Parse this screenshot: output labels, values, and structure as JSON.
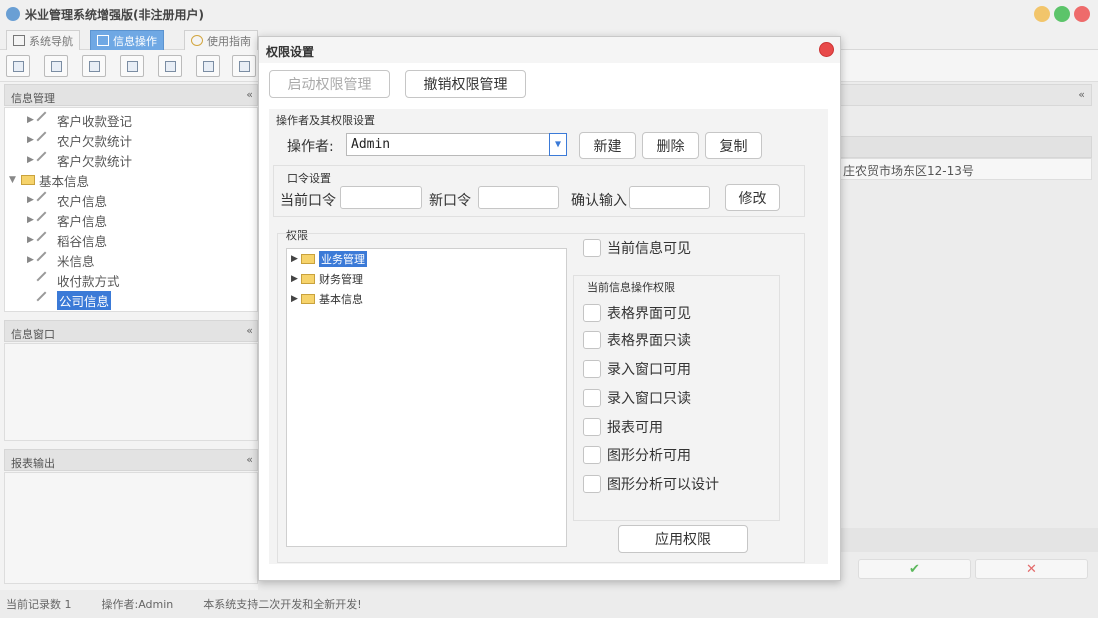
{
  "app": {
    "title": "米业管理系统增强版(非注册用户)"
  },
  "main_tabs": [
    {
      "label": "系统导航"
    },
    {
      "label": "信息操作"
    },
    {
      "label": "使用指南"
    }
  ],
  "left": {
    "info_mgmt_title": "信息管理",
    "tree": [
      {
        "label": "客户收款登记"
      },
      {
        "label": "农户欠款统计"
      },
      {
        "label": "客户欠款统计"
      },
      {
        "label": "基本信息"
      },
      {
        "label": "农户信息"
      },
      {
        "label": "客户信息"
      },
      {
        "label": "稻谷信息"
      },
      {
        "label": "米信息"
      },
      {
        "label": "收付款方式"
      },
      {
        "label": "公司信息"
      }
    ],
    "info_window_title": "信息窗口",
    "report_title": "报表输出"
  },
  "background": {
    "address_fragment": "庄农贸市场东区12-13号"
  },
  "status": {
    "record_count": "当前记录数 1",
    "operator": "操作者:Admin",
    "message": "本系统支持二次开发和全新开发!"
  },
  "dialog": {
    "title": "权限设置",
    "enable_btn": "启动权限管理",
    "revoke_btn": "撤销权限管理",
    "operator_group": "操作者及其权限设置",
    "operator_label": "操作者:",
    "operator_value": "Admin",
    "new_btn": "新建",
    "delete_btn": "删除",
    "copy_btn": "复制",
    "password_group": "口令设置",
    "current_pwd": "当前口令",
    "new_pwd": "新口令",
    "confirm_pwd": "确认输入",
    "modify_btn": "修改",
    "perm_group": "权限",
    "perm_tree": [
      {
        "label": "业务管理"
      },
      {
        "label": "财务管理"
      },
      {
        "label": "基本信息"
      }
    ],
    "visible_check": "当前信息可见",
    "ops_group": "当前信息操作权限",
    "ops": [
      {
        "label": "表格界面可见"
      },
      {
        "label": "表格界面只读"
      },
      {
        "label": "录入窗口可用"
      },
      {
        "label": "录入窗口只读"
      },
      {
        "label": "报表可用"
      },
      {
        "label": "图形分析可用"
      },
      {
        "label": "图形分析可以设计"
      }
    ],
    "apply_btn": "应用权限"
  },
  "colors": {
    "accent": "#3b7ad7",
    "tab_active": "#6fa8e4",
    "close": "#e84a4a"
  }
}
